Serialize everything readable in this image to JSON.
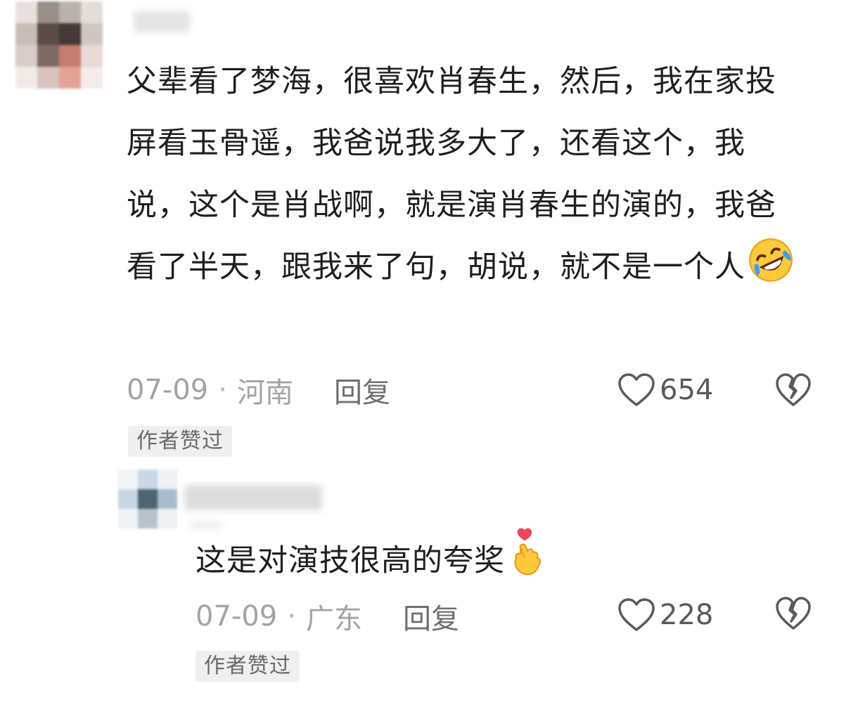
{
  "comments": [
    {
      "text": "父辈看了梦海，很喜欢肖春生，然后，我在家投屏看玉骨遥，我爸说我多大了，还看这个，我说，这个是肖战啊，就是演肖春生的演的，我爸看了半天，跟我来了句，胡说，就不是一个人",
      "emoji": "rolling-on-floor-laughing-emoji",
      "date": "07-09",
      "dot": "·",
      "location": "河南",
      "reply_label": "回复",
      "likes": "654",
      "badge": "作者赞过"
    },
    {
      "text": "这是对演技很高的夸奖",
      "emoji": "finger-heart-emoji",
      "date": "07-09",
      "dot": "·",
      "location": "广东",
      "reply_label": "回复",
      "likes": "228",
      "badge": "作者赞过"
    }
  ],
  "icons": {
    "like": "heart-outline-icon",
    "dislike": "broken-heart-outline-icon"
  },
  "colors": {
    "text": "#1f1f1f",
    "meta": "#a3a3a3",
    "badge_bg": "#efefef",
    "badge_text": "#6a6a6a",
    "icon": "#5a5a5a"
  }
}
